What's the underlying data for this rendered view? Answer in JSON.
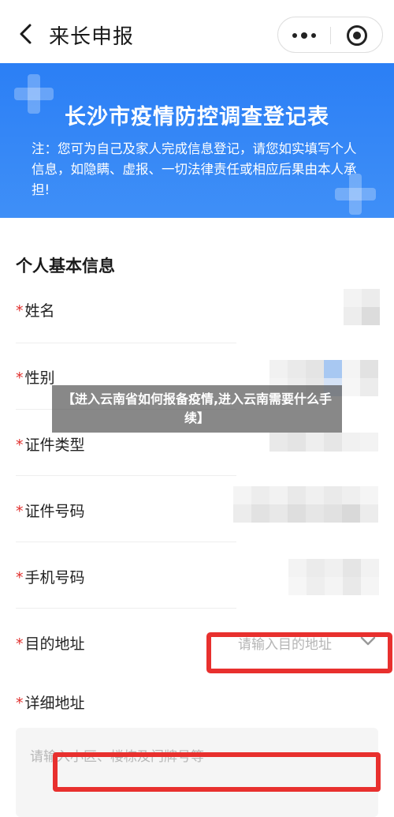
{
  "navbar": {
    "title": "来长申报"
  },
  "banner": {
    "title": "长沙市疫情防控调查登记表",
    "note": "注：您可为自己及家人完成信息登记，请您如实填写个人信息，如隐瞒、虚报、一切法律责任或相应后果由本人承担!"
  },
  "form": {
    "section_title": "个人基本信息",
    "required_mark": "*",
    "fields": [
      {
        "label": "姓名"
      },
      {
        "label": "性别"
      },
      {
        "label": "证件类型"
      },
      {
        "label": "证件号码"
      },
      {
        "label": "手机号码"
      },
      {
        "label": "目的地址",
        "placeholder": "请输入目的地址"
      },
      {
        "label": "详细地址",
        "placeholder": "请输入小区、楼栋及门牌号等"
      }
    ]
  },
  "overlay": {
    "caption": "【进入云南省如何报备疫情,进入云南需要什么手续】"
  },
  "colors": {
    "banner_blue": "#2b7ff5",
    "required_red": "#e0302e",
    "highlight_red": "#e8302e"
  },
  "icons": {
    "back": "chevron-left-icon",
    "more": "more-dots-icon",
    "close": "target-close-icon",
    "dropdown": "chevron-down-icon"
  }
}
